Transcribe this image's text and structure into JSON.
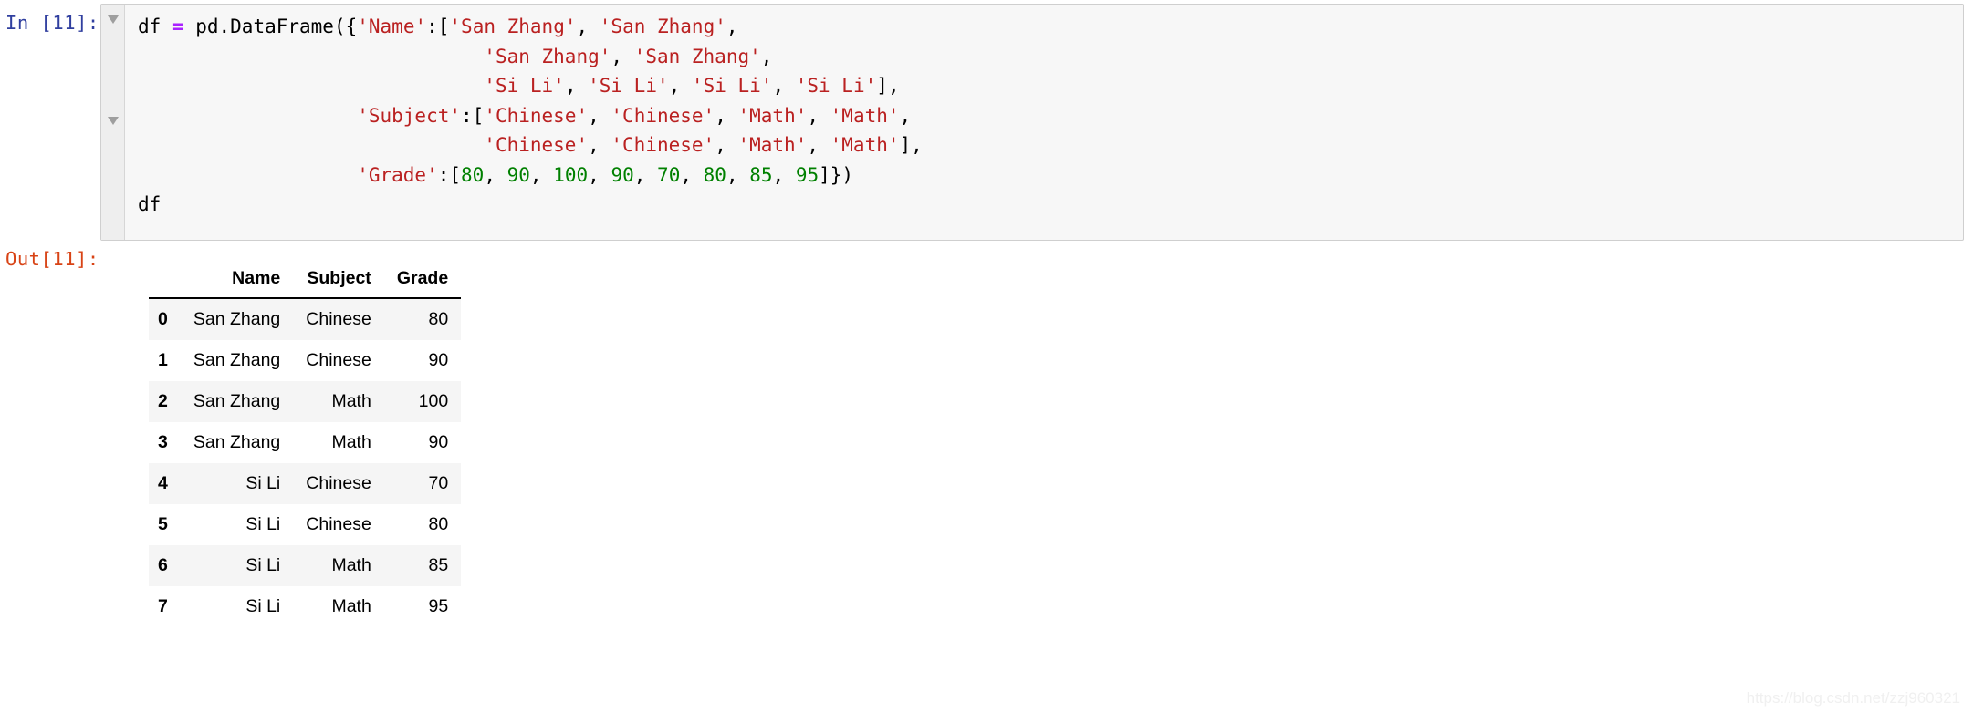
{
  "cell": {
    "input_prompt": "In [11]:",
    "output_prompt": "Out[11]:",
    "collapse_icon_1": "triangle-down-icon",
    "collapse_icon_2": "triangle-down-icon",
    "code_lines": [
      [
        {
          "t": "df ",
          "k": "plain"
        },
        {
          "t": "=",
          "k": "op"
        },
        {
          "t": " pd.DataFrame({",
          "k": "plain"
        },
        {
          "t": "'Name'",
          "k": "str"
        },
        {
          "t": ":[",
          "k": "plain"
        },
        {
          "t": "'San Zhang'",
          "k": "str"
        },
        {
          "t": ", ",
          "k": "plain"
        },
        {
          "t": "'San Zhang'",
          "k": "str"
        },
        {
          "t": ",",
          "k": "plain"
        }
      ],
      [
        {
          "t": "                              ",
          "k": "plain"
        },
        {
          "t": "'San Zhang'",
          "k": "str"
        },
        {
          "t": ", ",
          "k": "plain"
        },
        {
          "t": "'San Zhang'",
          "k": "str"
        },
        {
          "t": ",",
          "k": "plain"
        }
      ],
      [
        {
          "t": "                              ",
          "k": "plain"
        },
        {
          "t": "'Si Li'",
          "k": "str"
        },
        {
          "t": ", ",
          "k": "plain"
        },
        {
          "t": "'Si Li'",
          "k": "str"
        },
        {
          "t": ", ",
          "k": "plain"
        },
        {
          "t": "'Si Li'",
          "k": "str"
        },
        {
          "t": ", ",
          "k": "plain"
        },
        {
          "t": "'Si Li'",
          "k": "str"
        },
        {
          "t": "],",
          "k": "plain"
        }
      ],
      [
        {
          "t": "                   ",
          "k": "plain"
        },
        {
          "t": "'Subject'",
          "k": "str"
        },
        {
          "t": ":[",
          "k": "plain"
        },
        {
          "t": "'Chinese'",
          "k": "str"
        },
        {
          "t": ", ",
          "k": "plain"
        },
        {
          "t": "'Chinese'",
          "k": "str"
        },
        {
          "t": ", ",
          "k": "plain"
        },
        {
          "t": "'Math'",
          "k": "str"
        },
        {
          "t": ", ",
          "k": "plain"
        },
        {
          "t": "'Math'",
          "k": "str"
        },
        {
          "t": ",",
          "k": "plain"
        }
      ],
      [
        {
          "t": "                              ",
          "k": "plain"
        },
        {
          "t": "'Chinese'",
          "k": "str"
        },
        {
          "t": ", ",
          "k": "plain"
        },
        {
          "t": "'Chinese'",
          "k": "str"
        },
        {
          "t": ", ",
          "k": "plain"
        },
        {
          "t": "'Math'",
          "k": "str"
        },
        {
          "t": ", ",
          "k": "plain"
        },
        {
          "t": "'Math'",
          "k": "str"
        },
        {
          "t": "],",
          "k": "plain"
        }
      ],
      [
        {
          "t": "                   ",
          "k": "plain"
        },
        {
          "t": "'Grade'",
          "k": "str"
        },
        {
          "t": ":[",
          "k": "plain"
        },
        {
          "t": "80",
          "k": "num"
        },
        {
          "t": ", ",
          "k": "plain"
        },
        {
          "t": "90",
          "k": "num"
        },
        {
          "t": ", ",
          "k": "plain"
        },
        {
          "t": "100",
          "k": "num"
        },
        {
          "t": ", ",
          "k": "plain"
        },
        {
          "t": "90",
          "k": "num"
        },
        {
          "t": ", ",
          "k": "plain"
        },
        {
          "t": "70",
          "k": "num"
        },
        {
          "t": ", ",
          "k": "plain"
        },
        {
          "t": "80",
          "k": "num"
        },
        {
          "t": ", ",
          "k": "plain"
        },
        {
          "t": "85",
          "k": "num"
        },
        {
          "t": ", ",
          "k": "plain"
        },
        {
          "t": "95",
          "k": "num"
        },
        {
          "t": "]})",
          "k": "plain"
        }
      ],
      [
        {
          "t": "df",
          "k": "plain"
        }
      ]
    ]
  },
  "dataframe": {
    "index_header": "",
    "columns": [
      "Name",
      "Subject",
      "Grade"
    ],
    "index": [
      "0",
      "1",
      "2",
      "3",
      "4",
      "5",
      "6",
      "7"
    ],
    "rows": [
      [
        "San Zhang",
        "Chinese",
        "80"
      ],
      [
        "San Zhang",
        "Chinese",
        "90"
      ],
      [
        "San Zhang",
        "Math",
        "100"
      ],
      [
        "San Zhang",
        "Math",
        "90"
      ],
      [
        "Si Li",
        "Chinese",
        "70"
      ],
      [
        "Si Li",
        "Chinese",
        "80"
      ],
      [
        "Si Li",
        "Math",
        "85"
      ],
      [
        "Si Li",
        "Math",
        "95"
      ]
    ]
  },
  "watermark": {
    "text": "https://blog.csdn.net/zzj960321"
  },
  "colors": {
    "prompt_in": "#303F9F",
    "prompt_out": "#D84315",
    "string_token": "#BA2121",
    "number_token": "#008000",
    "operator_token": "#AA22FF",
    "cell_background": "#f7f7f7",
    "row_stripe": "#f5f5f5"
  }
}
